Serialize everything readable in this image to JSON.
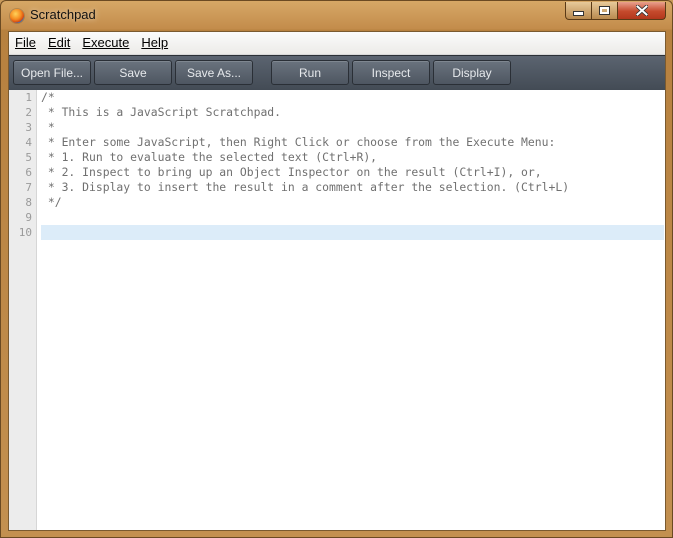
{
  "window": {
    "title": "Scratchpad",
    "icon": "firefox-icon"
  },
  "menu": {
    "file": "File",
    "edit": "Edit",
    "execute": "Execute",
    "help": "Help"
  },
  "toolbar": {
    "open_file": "Open File...",
    "save": "Save",
    "save_as": "Save As...",
    "run": "Run",
    "inspect": "Inspect",
    "display": "Display"
  },
  "editor": {
    "line_numbers": [
      "1",
      "2",
      "3",
      "4",
      "5",
      "6",
      "7",
      "8",
      "9",
      "10"
    ],
    "lines": [
      "/*",
      " * This is a JavaScript Scratchpad.",
      " *",
      " * Enter some JavaScript, then Right Click or choose from the Execute Menu:",
      " * 1. Run to evaluate the selected text (Ctrl+R),",
      " * 2. Inspect to bring up an Object Inspector on the result (Ctrl+I), or,",
      " * 3. Display to insert the result in a comment after the selection. (Ctrl+L)",
      " */",
      "",
      ""
    ],
    "active_line": 10
  }
}
